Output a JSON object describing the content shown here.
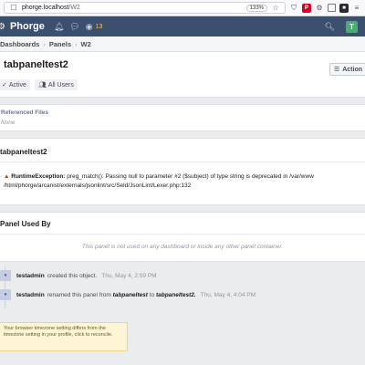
{
  "browser": {
    "host": "phorge.localhost",
    "path": "/W2",
    "zoom": "133%"
  },
  "header": {
    "brand": "Phorge",
    "notification_count": "13",
    "user_initial": "T"
  },
  "breadcrumbs": [
    "Dashboards",
    "Panels",
    "W2"
  ],
  "page": {
    "title": "tabpaneltest2",
    "status": "Active",
    "visibility": "All Users",
    "actions_label": "Action"
  },
  "referenced_files": {
    "label": "Referenced Files",
    "value": "None"
  },
  "error_panel": {
    "title": "tabpaneltest2",
    "exception_type": "RuntimeException:",
    "message_line1": "preg_match(): Passing null to parameter #2 ($subject) of type string is deprecated in /var/www",
    "message_line2": "/html/phorge/arcanist/externals/jsonlint/src/Seld/JsonLint/Lexer.php:132"
  },
  "used_by": {
    "title": "Panel Used By",
    "empty_text": "This panel is not used on any dashboard or inside any other panel container."
  },
  "timeline": [
    {
      "user": "testadmin",
      "action": "created this object.",
      "date": "Thu, May 4, 2:59 PM"
    },
    {
      "user": "testadmin",
      "action_pre": "renamed this panel from",
      "old_name": "tabpaneltest",
      "action_mid": "to",
      "new_name": "tabpaneltest2.",
      "date": "Thu, May 4, 4:04 PM"
    }
  ],
  "timezone_notice": "Your browser timezone setting differs from the timezone setting in your profile, click to reconcile.",
  "colors": {
    "header_bg": "#3b4f6f",
    "avatar_green": "#4cab6e",
    "warning_red": "#c0392b",
    "notice_bg": "#fdf5d4"
  }
}
